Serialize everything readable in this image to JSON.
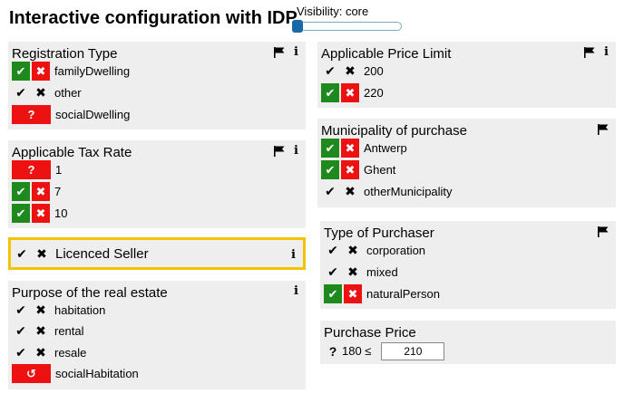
{
  "page": {
    "title": "Interactive configuration with IDP"
  },
  "visibility": {
    "label": "Visibility: core",
    "level_fraction": 0.0
  },
  "symbols": {
    "check": "✔",
    "cross": "✖",
    "unknown": "?",
    "undo": "↺"
  },
  "registration_type": {
    "title": "Registration Type",
    "options": [
      {
        "label": "familyDwelling",
        "state": "choice"
      },
      {
        "label": "other",
        "state": "plain"
      },
      {
        "label": "socialDwelling",
        "state": "unknown"
      }
    ]
  },
  "applicable_tax_rate": {
    "title": "Applicable Tax Rate",
    "options": [
      {
        "label": "1",
        "state": "unknown"
      },
      {
        "label": "7",
        "state": "choice"
      },
      {
        "label": "10",
        "state": "choice"
      }
    ]
  },
  "licenced_seller": {
    "label": "Licenced Seller"
  },
  "purpose": {
    "title": "Purpose of the real estate",
    "options": [
      {
        "label": "habitation",
        "state": "plain"
      },
      {
        "label": "rental",
        "state": "plain"
      },
      {
        "label": "resale",
        "state": "plain"
      },
      {
        "label": "socialHabitation",
        "state": "undo"
      }
    ]
  },
  "price_limit": {
    "title": "Applicable Price Limit",
    "options": [
      {
        "label": "200",
        "state": "plain"
      },
      {
        "label": "220",
        "state": "choice"
      }
    ]
  },
  "municipality": {
    "title": "Municipality of purchase",
    "options": [
      {
        "label": "Antwerp",
        "state": "choice"
      },
      {
        "label": "Ghent",
        "state": "choice"
      },
      {
        "label": "otherMunicipality",
        "state": "plain"
      }
    ]
  },
  "purchaser": {
    "title": "Type of Purchaser",
    "options": [
      {
        "label": "corporation",
        "state": "plain"
      },
      {
        "label": "mixed",
        "state": "plain"
      },
      {
        "label": "naturalPerson",
        "state": "choice"
      }
    ]
  },
  "purchase_price": {
    "title": "Purchase Price",
    "prefix": "180 ≤",
    "value": "210"
  }
}
